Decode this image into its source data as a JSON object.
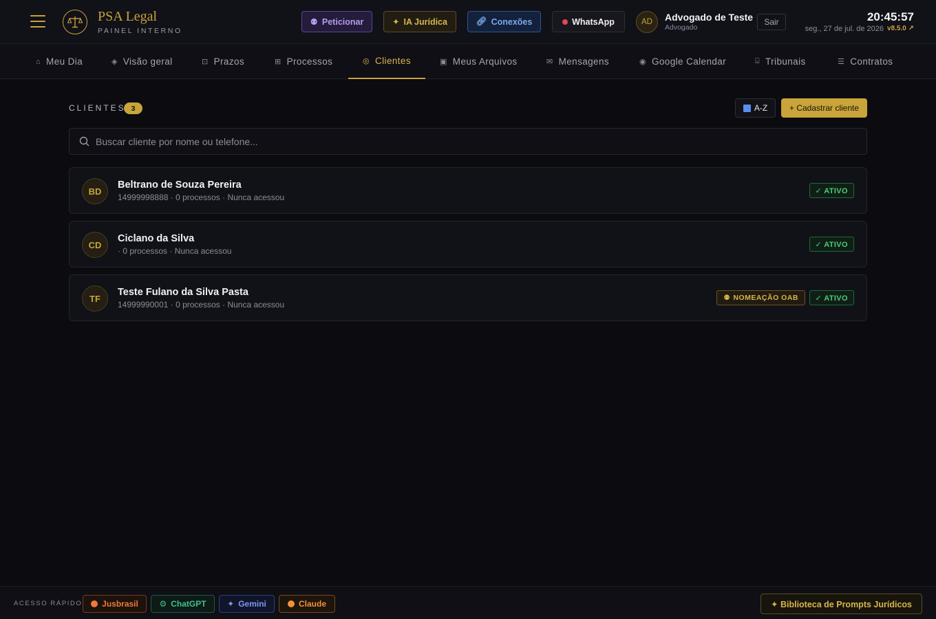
{
  "header": {
    "brand_name": "PSA Legal",
    "brand_sub": "PAINEL INTERNO",
    "buttons": {
      "peticionar": "Peticionar",
      "ia": "IA Jurídica",
      "conexoes": "Conexões",
      "whatsapp": "WhatsApp"
    },
    "user": {
      "initials": "AD",
      "name": "Advogado de Teste",
      "role": "Advogado"
    },
    "logout": "Sair",
    "clock": "20:45:57",
    "date": "seg., 27 de jul. de 2026",
    "version": "v8.5.0 ↗"
  },
  "nav": {
    "items": [
      {
        "label": "Meu Dia",
        "icon": "⌂"
      },
      {
        "label": "Visão geral",
        "icon": "◈"
      },
      {
        "label": "Prazos",
        "icon": "⊡"
      },
      {
        "label": "Processos",
        "icon": "⊞"
      },
      {
        "label": "Clientes",
        "icon": "◎"
      },
      {
        "label": "Meus Arquivos",
        "icon": "▣"
      },
      {
        "label": "Mensagens",
        "icon": "✉"
      },
      {
        "label": "Google Calendar",
        "icon": "◉"
      },
      {
        "label": "Tribunais",
        "icon": "⌸"
      },
      {
        "label": "Contratos",
        "icon": "☰"
      }
    ],
    "active": "Clientes"
  },
  "clients_section": {
    "title": "CLIENTES",
    "count": "3",
    "sort_label": "A-Z",
    "add_label": "+ Cadastrar cliente",
    "search_placeholder": "Buscar cliente por nome ou telefone...",
    "clients": [
      {
        "initials": "BD",
        "name": "Beltrano de Souza Pereira",
        "meta": "14999998888 · 0 processos · Nunca acessou",
        "status": "✓ ATIVO"
      },
      {
        "initials": "CD",
        "name": "Ciclano da Silva",
        "meta": "· 0 processos · Nunca acessou",
        "status": "✓ ATIVO"
      },
      {
        "initials": "TF",
        "name": "Teste Fulano da Silva Pasta",
        "meta": "14999990001 · 0 processos · Nunca acessou",
        "tag": "NOMEAÇÃO OAB",
        "status": "✓ ATIVO"
      }
    ]
  },
  "footer": {
    "quick_label": "ACESSO RÁPIDO",
    "links": {
      "jusbrasil": "Jusbrasil",
      "chatgpt": "ChatGPT",
      "gemini": "Gemini",
      "claude": "Claude"
    },
    "library": "✦ Biblioteca de Prompts Jurídicos"
  },
  "colors": {
    "accent": "#c9a43a",
    "background": "#0b0b10",
    "success": "#4cc97a"
  }
}
